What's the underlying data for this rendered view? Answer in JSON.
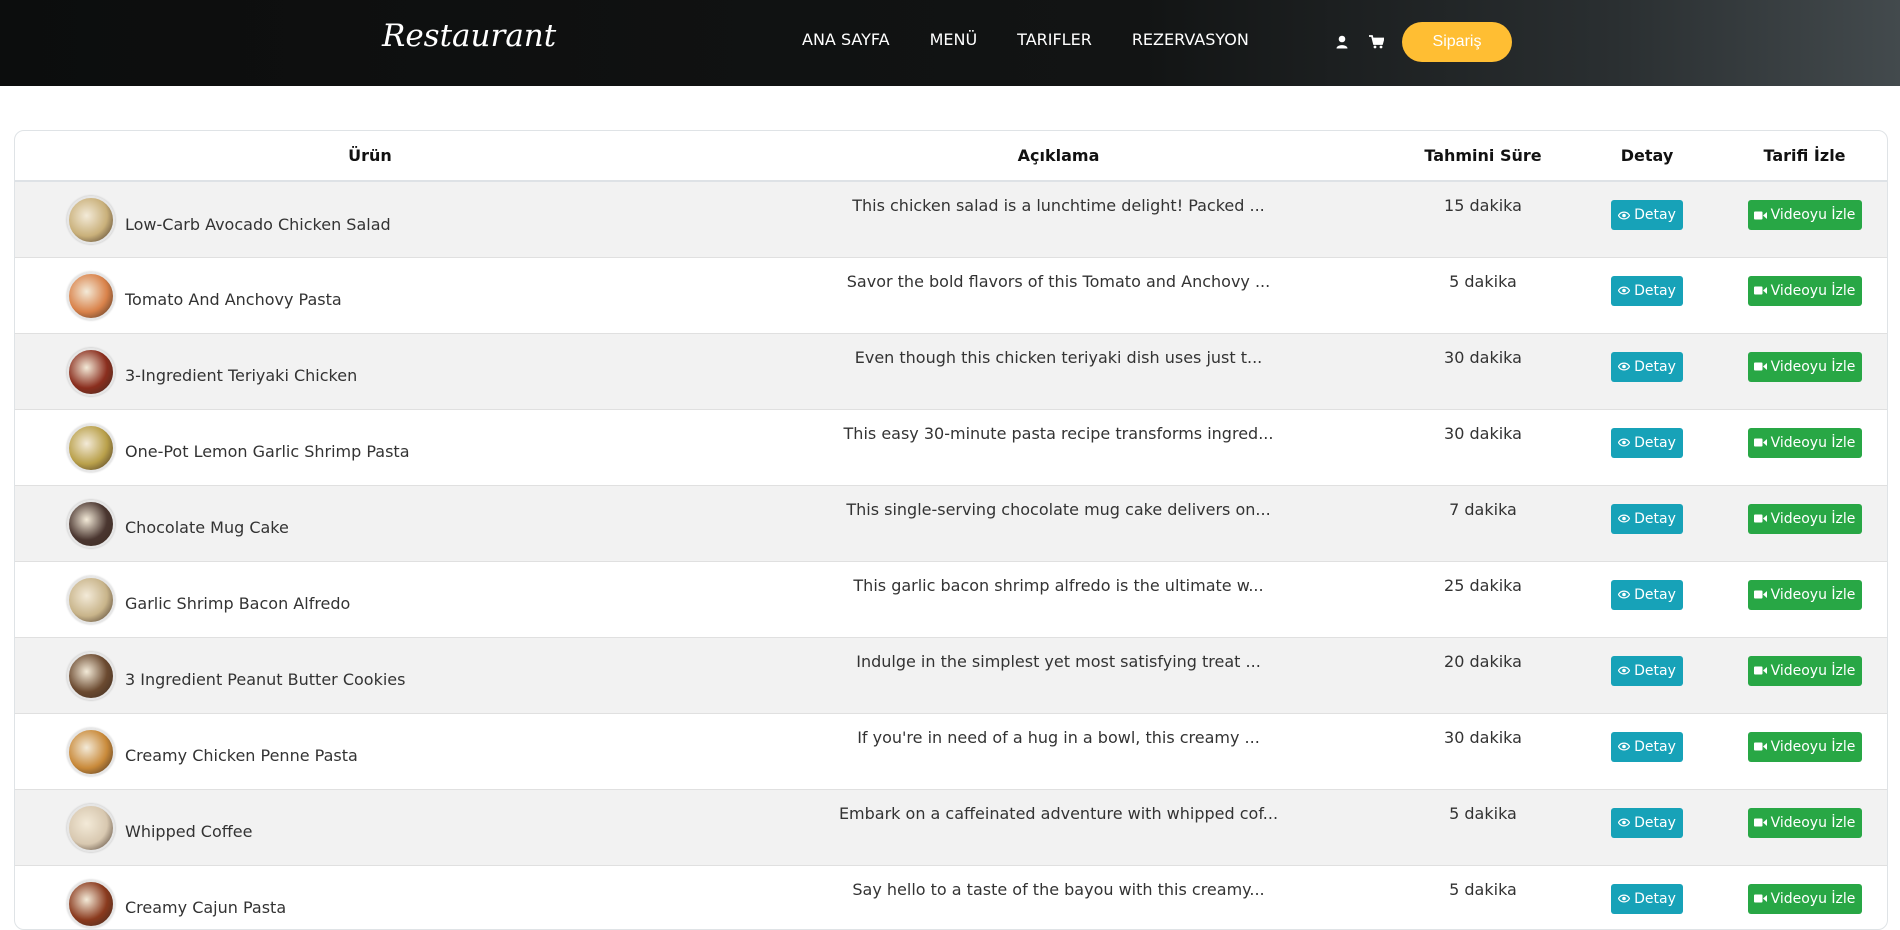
{
  "brand": "Restaurant",
  "nav": {
    "links": [
      "ANA SAYFA",
      "MENÜ",
      "TARIFLER",
      "REZERVASYON"
    ],
    "user_icon": "user-icon",
    "cart_icon": "shopping-cart-icon",
    "order_label": "Sipariş"
  },
  "colors": {
    "accent": "#ffbe33",
    "info": "#17a2b8",
    "success": "#28a745"
  },
  "table": {
    "headers": [
      "Ürün",
      "Açıklama",
      "Tahmini Süre",
      "Detay",
      "Tarifi İzle"
    ],
    "detail_label": "Detay",
    "video_label": "Videoyu İzle",
    "rows": [
      {
        "name": "Low-Carb Avocado Chicken Salad",
        "desc": "This chicken salad is a lunchtime delight! Packed ...",
        "time": "15 dakika",
        "thumb_color": "#c9b07a"
      },
      {
        "name": "Tomato And Anchovy Pasta",
        "desc": "Savor the bold flavors of this Tomato and Anchovy ...",
        "time": "5 dakika",
        "thumb_color": "#d9824a"
      },
      {
        "name": "3-Ingredient Teriyaki Chicken",
        "desc": "Even though this chicken teriyaki dish uses just t...",
        "time": "30 dakika",
        "thumb_color": "#8a2e1e"
      },
      {
        "name": "One-Pot Lemon Garlic Shrimp Pasta",
        "desc": "This easy 30-minute pasta recipe transforms ingred...",
        "time": "30 dakika",
        "thumb_color": "#b9a04a"
      },
      {
        "name": "Chocolate Mug Cake",
        "desc": "This single-serving chocolate mug cake delivers on...",
        "time": "7 dakika",
        "thumb_color": "#4a3630"
      },
      {
        "name": "Garlic Shrimp Bacon Alfredo",
        "desc": "This garlic bacon shrimp alfredo is the ultimate w...",
        "time": "25 dakika",
        "thumb_color": "#c8b48a"
      },
      {
        "name": "3 Ingredient Peanut Butter Cookies",
        "desc": "Indulge in the simplest yet most satisfying treat ...",
        "time": "20 dakika",
        "thumb_color": "#6b4a30"
      },
      {
        "name": "Creamy Chicken Penne Pasta",
        "desc": "If you're in need of a hug in a bowl, this creamy ...",
        "time": "30 dakika",
        "thumb_color": "#c98a3a"
      },
      {
        "name": "Whipped Coffee",
        "desc": "Embark on a caffeinated adventure with whipped cof...",
        "time": "5 dakika",
        "thumb_color": "#d8c8b0"
      },
      {
        "name": "Creamy Cajun Pasta",
        "desc": "Say hello to a taste of the bayou with this creamy...",
        "time": "5 dakika",
        "thumb_color": "#8a3a1e"
      }
    ]
  }
}
